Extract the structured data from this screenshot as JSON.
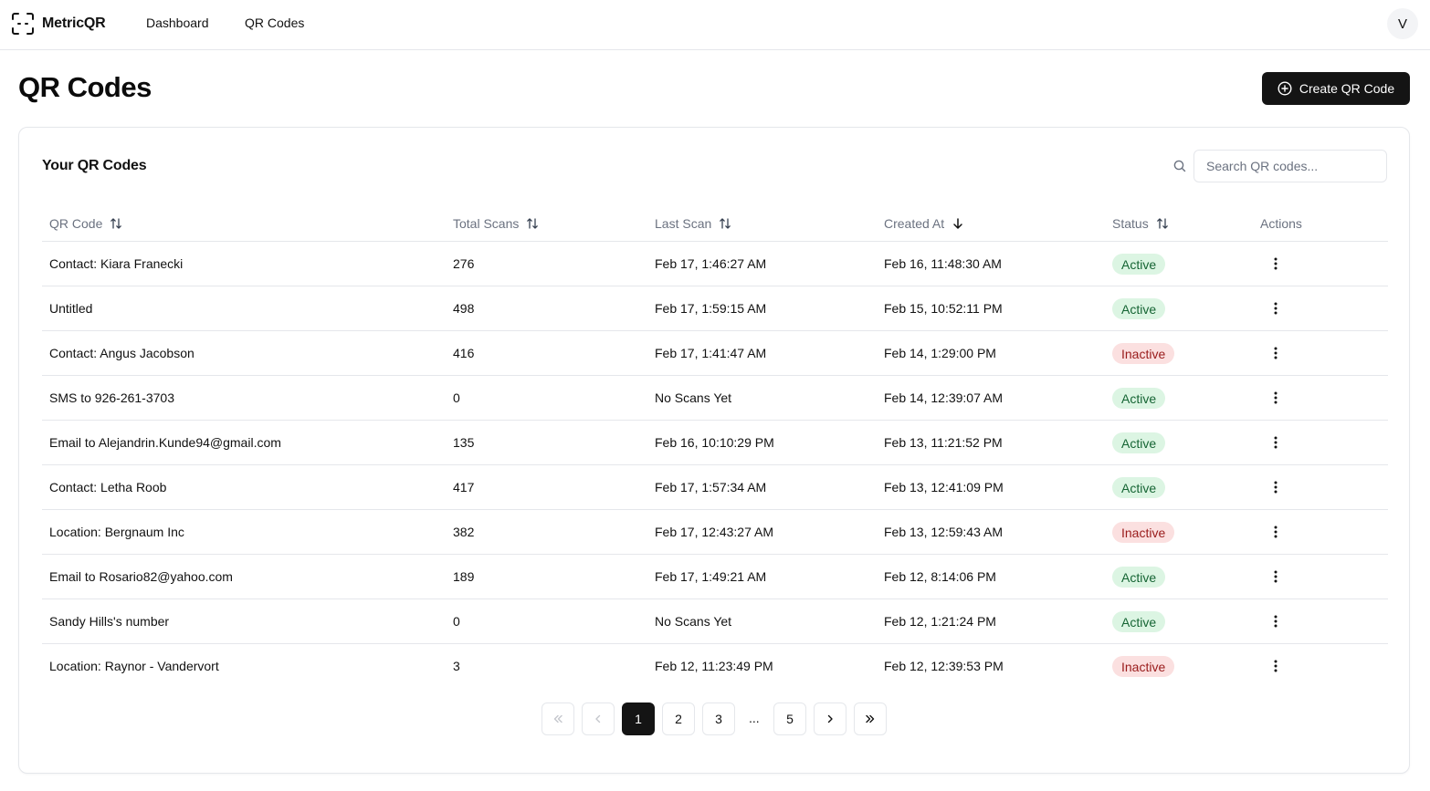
{
  "brand": {
    "name": "MetricQR"
  },
  "nav": {
    "dashboard": "Dashboard",
    "qr_codes": "QR Codes"
  },
  "user": {
    "initial": "V"
  },
  "page": {
    "title": "QR Codes",
    "create_label": "Create QR Code"
  },
  "card": {
    "title": "Your QR Codes"
  },
  "search": {
    "placeholder": "Search QR codes..."
  },
  "table": {
    "columns": {
      "qr_code": "QR Code",
      "total_scans": "Total Scans",
      "last_scan": "Last Scan",
      "created_at": "Created At",
      "status": "Status",
      "actions": "Actions"
    },
    "rows": [
      {
        "name": "Contact: Kiara Franecki",
        "scans": "276",
        "last_scan": "Feb 17, 1:46:27 AM",
        "created": "Feb 16, 11:48:30 AM",
        "status": "Active"
      },
      {
        "name": "Untitled",
        "scans": "498",
        "last_scan": "Feb 17, 1:59:15 AM",
        "created": "Feb 15, 10:52:11 PM",
        "status": "Active"
      },
      {
        "name": "Contact: Angus Jacobson",
        "scans": "416",
        "last_scan": "Feb 17, 1:41:47 AM",
        "created": "Feb 14, 1:29:00 PM",
        "status": "Inactive"
      },
      {
        "name": "SMS to 926-261-3703",
        "scans": "0",
        "last_scan": "No Scans Yet",
        "created": "Feb 14, 12:39:07 AM",
        "status": "Active"
      },
      {
        "name": "Email to Alejandrin.Kunde94@gmail.com",
        "scans": "135",
        "last_scan": "Feb 16, 10:10:29 PM",
        "created": "Feb 13, 11:21:52 PM",
        "status": "Active"
      },
      {
        "name": "Contact: Letha Roob",
        "scans": "417",
        "last_scan": "Feb 17, 1:57:34 AM",
        "created": "Feb 13, 12:41:09 PM",
        "status": "Active"
      },
      {
        "name": "Location: Bergnaum Inc",
        "scans": "382",
        "last_scan": "Feb 17, 12:43:27 AM",
        "created": "Feb 13, 12:59:43 AM",
        "status": "Inactive"
      },
      {
        "name": "Email to Rosario82@yahoo.com",
        "scans": "189",
        "last_scan": "Feb 17, 1:49:21 AM",
        "created": "Feb 12, 8:14:06 PM",
        "status": "Active"
      },
      {
        "name": "Sandy Hills's number",
        "scans": "0",
        "last_scan": "No Scans Yet",
        "created": "Feb 12, 1:21:24 PM",
        "status": "Active"
      },
      {
        "name": "Location: Raynor - Vandervort",
        "scans": "3",
        "last_scan": "Feb 12, 11:23:49 PM",
        "created": "Feb 12, 12:39:53 PM",
        "status": "Inactive"
      }
    ]
  },
  "pagination": {
    "pages": [
      "1",
      "2",
      "3",
      "5"
    ],
    "current": "1",
    "ellipsis": "..."
  },
  "colors": {
    "primary": "#141414",
    "active_bg": "#dcf5e3",
    "active_text": "#166534",
    "inactive_bg": "#fbe0e0",
    "inactive_text": "#991b1b"
  }
}
